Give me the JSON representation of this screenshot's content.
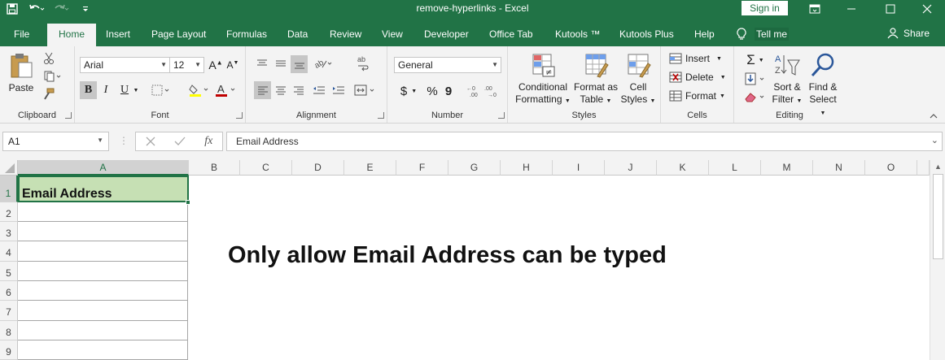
{
  "window": {
    "title": "remove-hyperlinks  -  Excel",
    "sign_in": "Sign in"
  },
  "tabs": [
    "File",
    "Home",
    "Insert",
    "Page Layout",
    "Formulas",
    "Data",
    "Review",
    "View",
    "Developer",
    "Office Tab",
    "Kutools ™",
    "Kutools Plus",
    "Help"
  ],
  "tell_me": "Tell me",
  "share": "Share",
  "ribbon": {
    "clipboard": {
      "paste": "Paste",
      "label": "Clipboard"
    },
    "font": {
      "name": "Arial",
      "size": "12",
      "bold": "B",
      "italic": "I",
      "underline": "U",
      "label": "Font"
    },
    "alignment": {
      "label": "Alignment"
    },
    "number": {
      "format": "General",
      "currency": "$",
      "percent": "%",
      "comma": "9",
      "label": "Number"
    },
    "styles": {
      "conditional": [
        "Conditional",
        "Formatting"
      ],
      "format_table": [
        "Format as",
        "Table"
      ],
      "cell_styles": [
        "Cell",
        "Styles"
      ],
      "label": "Styles"
    },
    "cells": {
      "insert": "Insert",
      "delete": "Delete",
      "format": "Format",
      "label": "Cells"
    },
    "editing": {
      "sort": [
        "Sort &",
        "Filter"
      ],
      "find": [
        "Find &",
        "Select"
      ],
      "label": "Editing"
    }
  },
  "formula_bar": {
    "name_box": "A1",
    "fx": "fx",
    "content": "Email Address"
  },
  "columns": [
    "A",
    "B",
    "C",
    "D",
    "E",
    "F",
    "G",
    "H",
    "I",
    "J",
    "K",
    "L",
    "M",
    "N",
    "O"
  ],
  "rows": [
    "1",
    "2",
    "3",
    "4",
    "5",
    "6",
    "7",
    "8",
    "9"
  ],
  "cells": {
    "A1": "Email Address"
  },
  "overlay_text": "Only allow Email Address can be typed",
  "colors": {
    "excel_green": "#217346",
    "selected_fill": "#c6e0b4"
  }
}
